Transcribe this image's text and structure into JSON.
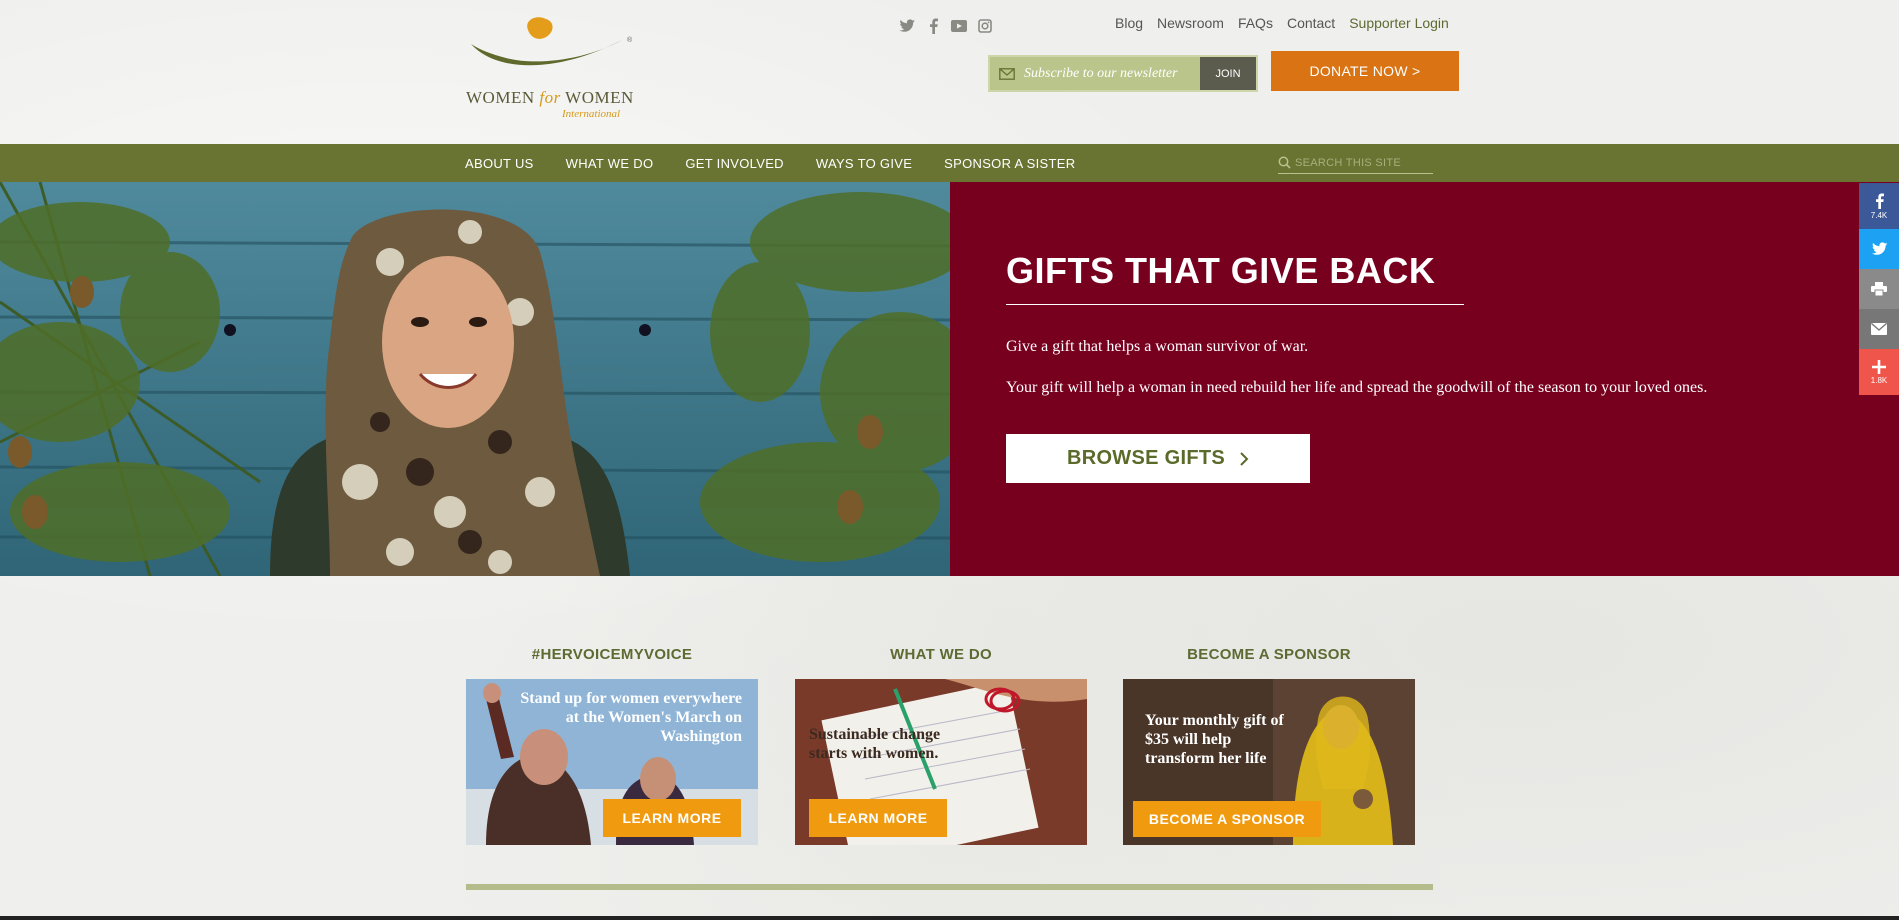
{
  "brand": {
    "logo_text": "WOMEN",
    "logo_for": "for",
    "logo_text2": "WOMEN",
    "logo_sub": "International"
  },
  "header": {
    "social": [
      "twitter-icon",
      "facebook-icon",
      "youtube-icon",
      "instagram-icon"
    ],
    "links": [
      "Blog",
      "Newsroom",
      "FAQs",
      "Contact",
      "Supporter Login"
    ],
    "newsletter_placeholder": "Subscribe to our newsletter",
    "join_label": "JOIN",
    "donate_label": "DONATE NOW >"
  },
  "nav": {
    "items": [
      "ABOUT US",
      "WHAT WE DO",
      "GET INVOLVED",
      "WAYS TO GIVE",
      "SPONSOR A SISTER"
    ],
    "search_placeholder": "SEARCH THIS SITE"
  },
  "hero": {
    "title": "GIFTS THAT GIVE BACK",
    "p1": "Give a gift that helps a woman survivor of war.",
    "p2": "Your gift will help a woman in need rebuild her life and spread the goodwill of the season to your loved ones.",
    "button": "BROWSE GIFTS"
  },
  "share": {
    "facebook_count": "7.4K",
    "plus_count": "1.8K"
  },
  "cards": [
    {
      "title": "#HERVOICEMYVOICE",
      "caption": "Stand up for women everywhere at the Women's March on Washington",
      "button": "LEARN MORE"
    },
    {
      "title": "WHAT WE DO",
      "caption": "Sustainable change starts with women.",
      "button": "LEARN MORE"
    },
    {
      "title": "BECOME A SPONSOR",
      "caption": "Your monthly gift of  $35 will help transform her life",
      "button": "BECOME A SPONSOR"
    }
  ],
  "colors": {
    "nav": "#6a7432",
    "hero_panel": "#78001f",
    "donate": "#d97313",
    "card_button": "#f09a0f"
  }
}
